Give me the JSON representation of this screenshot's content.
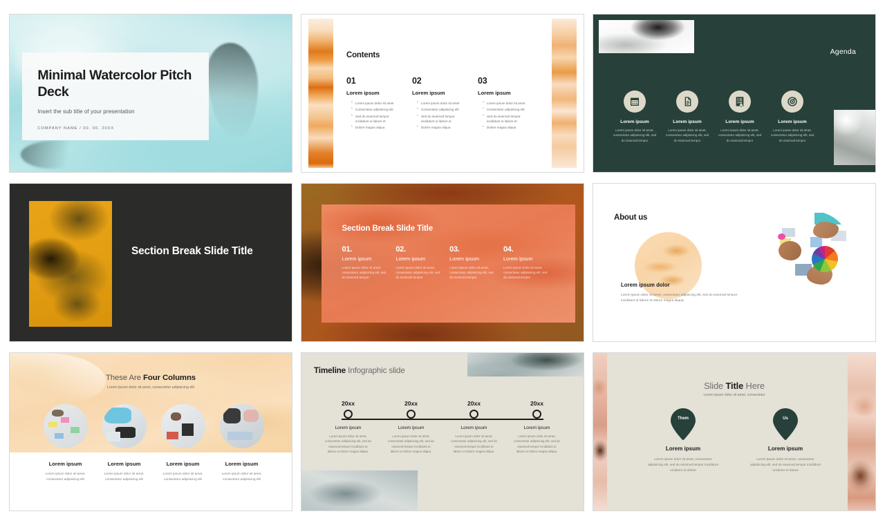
{
  "meta": {
    "colors": {
      "teal": "#a4dde1",
      "dark_green": "#27403a",
      "charcoal": "#2b2b29",
      "orange": "#e8a316",
      "coral": "#ee7e58",
      "beige": "#e4e1d6",
      "cream_circle": "#ddd9c8"
    }
  },
  "slides": [
    {
      "id": "title-slide",
      "title": "Minimal Watercolor Pitch Deck",
      "subtitle": "Insert the sub title of your presentation",
      "meta": "COMPANY NAME  /  00. 00. 20XX"
    },
    {
      "id": "contents-slide",
      "heading": "Contents",
      "columns": [
        {
          "number": "01",
          "title": "Lorem ipsum",
          "bullets": [
            "Lorem ipsum dolor sit amet",
            "Consectetur adipisicing elit",
            "Sed do eiusmod tempor incididunt ut labore et",
            "Dolore magna aliqua"
          ]
        },
        {
          "number": "02",
          "title": "Lorem ipsum",
          "bullets": [
            "Lorem ipsum dolor sit amet",
            "Consectetur adipisicing elit",
            "Sed do eiusmod tempor incididunt ut labore et",
            "Dolore magna aliqua"
          ]
        },
        {
          "number": "03",
          "title": "Lorem ipsum",
          "bullets": [
            "Lorem ipsum dolor sit amet",
            "Consectetur adipisicing elit",
            "Sed do eiusmod tempor incididunt ut labore et",
            "Dolore magna aliqua"
          ]
        }
      ]
    },
    {
      "id": "agenda-slide",
      "title": "Agenda",
      "items": [
        {
          "icon": "calendar-icon",
          "title": "Lorem ipsum",
          "body": "Lorem ipsum dolor sit amet, consectetur adipisicing elit, sed do eiusmod tempor"
        },
        {
          "icon": "document-icon",
          "title": "Lorem ipsum",
          "body": "Lorem ipsum dolor sit amet, consectetur adipisicing elit, sed do eiusmod tempor"
        },
        {
          "icon": "report-icon",
          "title": "Lorem ipsum",
          "body": "Lorem ipsum dolor sit amet, consectetur adipisicing elit, sed do eiusmod tempor"
        },
        {
          "icon": "target-icon",
          "title": "Lorem ipsum",
          "body": "Lorem ipsum dolor sit amet, consectetur adipisicing elit, sed do eiusmod tempor"
        }
      ]
    },
    {
      "id": "section-break-dark-slide",
      "title": "Section Break Slide Title"
    },
    {
      "id": "section-break-coral-slide",
      "title": "Section Break Slide Title",
      "columns": [
        {
          "number": "01.",
          "title": "Lorem ipsum",
          "body": "Lorem ipsum dolor sit amet, consectetur adipisicing elit, sed do eiusmod tempor"
        },
        {
          "number": "02.",
          "title": "Lorem ipsum",
          "body": "Lorem ipsum dolor sit amet, consectetur adipisicing elit, sed do eiusmod tempor"
        },
        {
          "number": "03.",
          "title": "Lorem ipsum",
          "body": "Lorem ipsum dolor sit amet, consectetur adipisicing elit, sed do eiusmod tempor"
        },
        {
          "number": "04.",
          "title": "Lorem ipsum",
          "body": "Lorem ipsum dolor sit amet, consectetur adipisicing elit, sed do eiusmod tempor"
        }
      ]
    },
    {
      "id": "about-us-slide",
      "title": "About us",
      "caption": "Lorem ipsum dolor",
      "body": "Lorem ipsum dolor sit amet, consectetur adipiscing elit, sed do eiusmod tempor incididunt ut labore et dolore magna aliqua."
    },
    {
      "id": "four-columns-slide",
      "title_light": "These Are ",
      "title_bold": "Four Columns",
      "subtitle": "Lorem ipsum dolor sit amet, consectetur adipisicing elit",
      "columns": [
        {
          "title": "Lorem ipsum",
          "body": "Lorem ipsum dolor sit amet, consectetur adipisicing elit"
        },
        {
          "title": "Lorem ipsum",
          "body": "Lorem ipsum dolor sit amet, consectetur adipisicing elit"
        },
        {
          "title": "Lorem ipsum",
          "body": "Lorem ipsum dolor sit amet, consectetur adipisicing elit"
        },
        {
          "title": "Lorem ipsum",
          "body": "Lorem ipsum dolor sit amet, consectetur adipisicing elit"
        }
      ]
    },
    {
      "id": "timeline-slide",
      "title_bold": "Timeline",
      "title_light": " Infographic slide",
      "nodes": [
        {
          "year": "20xx",
          "title": "Lorem ipsum",
          "body": "Lorem ipsum dolor sit amet, consectetur adipisicing elit, sed do eiusmod tempor incididunt ut labore et dolore magna aliqua."
        },
        {
          "year": "20xx",
          "title": "Lorem ipsum",
          "body": "Lorem ipsum dolor sit amet, consectetur adipisicing elit, sed do eiusmod tempor incididunt ut labore et dolore magna aliqua."
        },
        {
          "year": "20xx",
          "title": "Lorem ipsum",
          "body": "Lorem ipsum dolor sit amet, consectetur adipisicing elit, sed do eiusmod tempor incididunt ut labore et dolore magna aliqua."
        },
        {
          "year": "20xx",
          "title": "Lorem ipsum",
          "body": "Lorem ipsum dolor sit amet, consectetur adipisicing elit, sed do eiusmod tempor incididunt ut labore et dolore magna aliqua."
        }
      ]
    },
    {
      "id": "comparison-slide",
      "title_light_1": "Slide ",
      "title_bold": "Title",
      "title_light_2": " Here",
      "subtitle": "Lorem ipsum dolor sit amet, consectetur",
      "columns": [
        {
          "pin": "Them",
          "title": "Lorem ipsum",
          "body": "Lorem ipsum dolor sit amet, consectetur adipisicing elit, sed do eiusmod tempor incididunt ut labore et dolore"
        },
        {
          "pin": "Us",
          "title": "Lorem ipsum",
          "body": "Lorem ipsum dolor sit amet, consectetur adipisicing elit, sed do eiusmod tempor incididunt ut labore et dolore"
        }
      ]
    }
  ]
}
